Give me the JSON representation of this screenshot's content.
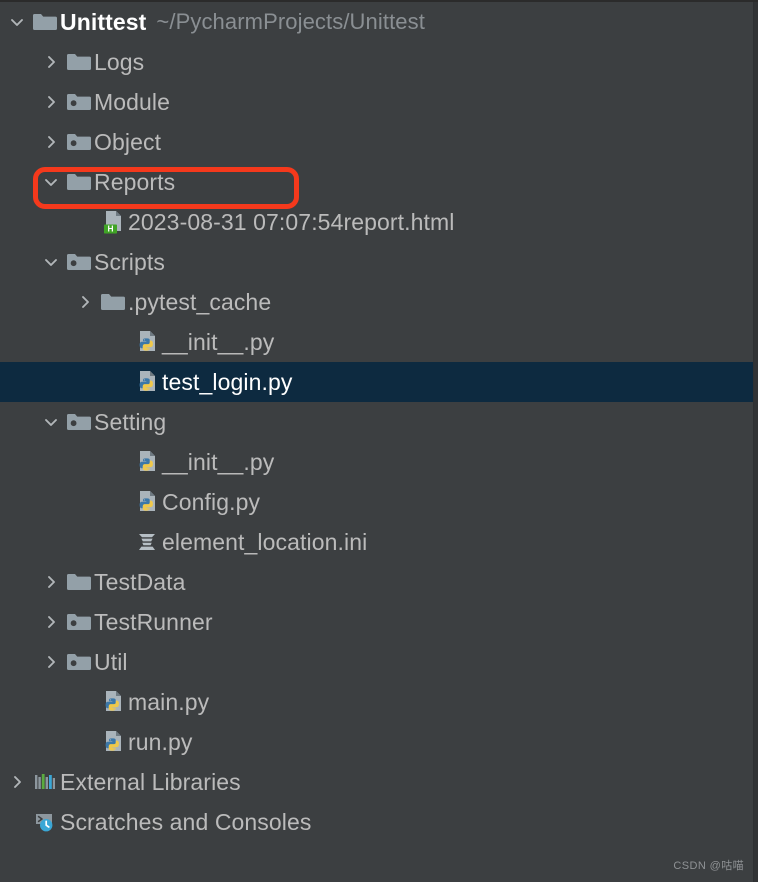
{
  "window": {
    "background_color": "#3c3f41",
    "selection_color": "#0d2a40",
    "text_color": "#bbbbbb",
    "accent_color": "#f5391c"
  },
  "project_tree": {
    "rows": [
      {
        "label": "Unittest",
        "secondary": "~/PycharmProjects/Unittest",
        "icon": "folder-icon",
        "arrow": "chevron-down-icon",
        "indent": 0,
        "kind": "project-root",
        "selected": false,
        "annotated": false
      },
      {
        "label": "Logs",
        "secondary": "",
        "icon": "folder-icon",
        "arrow": "chevron-right-icon",
        "indent": 1,
        "kind": "folder",
        "selected": false,
        "annotated": false
      },
      {
        "label": "Module",
        "secondary": "",
        "icon": "folder-source-root-icon",
        "arrow": "chevron-right-icon",
        "indent": 1,
        "kind": "folder",
        "selected": false,
        "annotated": false
      },
      {
        "label": "Object",
        "secondary": "",
        "icon": "folder-source-root-icon",
        "arrow": "chevron-right-icon",
        "indent": 1,
        "kind": "folder",
        "selected": false,
        "annotated": false
      },
      {
        "label": "Reports",
        "secondary": "",
        "icon": "folder-icon",
        "arrow": "chevron-down-icon",
        "indent": 1,
        "kind": "folder",
        "selected": false,
        "annotated": true
      },
      {
        "label": "2023-08-31 07:07:54report.html",
        "secondary": "",
        "icon": "html-file-icon",
        "arrow": "none",
        "indent": 2,
        "kind": "file",
        "selected": false,
        "annotated": false
      },
      {
        "label": "Scripts",
        "secondary": "",
        "icon": "folder-source-root-icon",
        "arrow": "chevron-down-icon",
        "indent": 1,
        "kind": "folder",
        "selected": false,
        "annotated": false
      },
      {
        "label": ".pytest_cache",
        "secondary": "",
        "icon": "folder-icon",
        "arrow": "chevron-right-icon",
        "indent": 2,
        "kind": "folder",
        "selected": false,
        "annotated": false
      },
      {
        "label": "__init__.py",
        "secondary": "",
        "icon": "python-file-icon",
        "arrow": "none",
        "indent": 3,
        "kind": "file",
        "selected": false,
        "annotated": false
      },
      {
        "label": "test_login.py",
        "secondary": "",
        "icon": "python-file-icon",
        "arrow": "none",
        "indent": 3,
        "kind": "file",
        "selected": true,
        "annotated": false
      },
      {
        "label": "Setting",
        "secondary": "",
        "icon": "folder-source-root-icon",
        "arrow": "chevron-down-icon",
        "indent": 1,
        "kind": "folder",
        "selected": false,
        "annotated": false
      },
      {
        "label": "__init__.py",
        "secondary": "",
        "icon": "python-file-icon",
        "arrow": "none",
        "indent": 3,
        "kind": "file",
        "selected": false,
        "annotated": false
      },
      {
        "label": "Config.py",
        "secondary": "",
        "icon": "python-file-icon",
        "arrow": "none",
        "indent": 3,
        "kind": "file",
        "selected": false,
        "annotated": false
      },
      {
        "label": "element_location.ini",
        "secondary": "",
        "icon": "ini-file-icon",
        "arrow": "none",
        "indent": 3,
        "kind": "file",
        "selected": false,
        "annotated": false
      },
      {
        "label": "TestData",
        "secondary": "",
        "icon": "folder-icon",
        "arrow": "chevron-right-icon",
        "indent": 1,
        "kind": "folder",
        "selected": false,
        "annotated": false
      },
      {
        "label": "TestRunner",
        "secondary": "",
        "icon": "folder-source-root-icon",
        "arrow": "chevron-right-icon",
        "indent": 1,
        "kind": "folder",
        "selected": false,
        "annotated": false
      },
      {
        "label": "Util",
        "secondary": "",
        "icon": "folder-source-root-icon",
        "arrow": "chevron-right-icon",
        "indent": 1,
        "kind": "folder",
        "selected": false,
        "annotated": false
      },
      {
        "label": "main.py",
        "secondary": "",
        "icon": "python-file-icon",
        "arrow": "none",
        "indent": 2,
        "kind": "file",
        "selected": false,
        "annotated": false
      },
      {
        "label": "run.py",
        "secondary": "",
        "icon": "python-file-icon",
        "arrow": "none",
        "indent": 2,
        "kind": "file",
        "selected": false,
        "annotated": false
      },
      {
        "label": "External Libraries",
        "secondary": "",
        "icon": "external-libraries-icon",
        "arrow": "chevron-right-icon",
        "indent": 0,
        "kind": "node",
        "selected": false,
        "annotated": false
      },
      {
        "label": "Scratches and Consoles",
        "secondary": "",
        "icon": "scratches-consoles-icon",
        "arrow": "none",
        "indent": 0,
        "kind": "node",
        "selected": false,
        "annotated": false
      }
    ]
  },
  "watermark": {
    "text": "CSDN @咕喵"
  }
}
